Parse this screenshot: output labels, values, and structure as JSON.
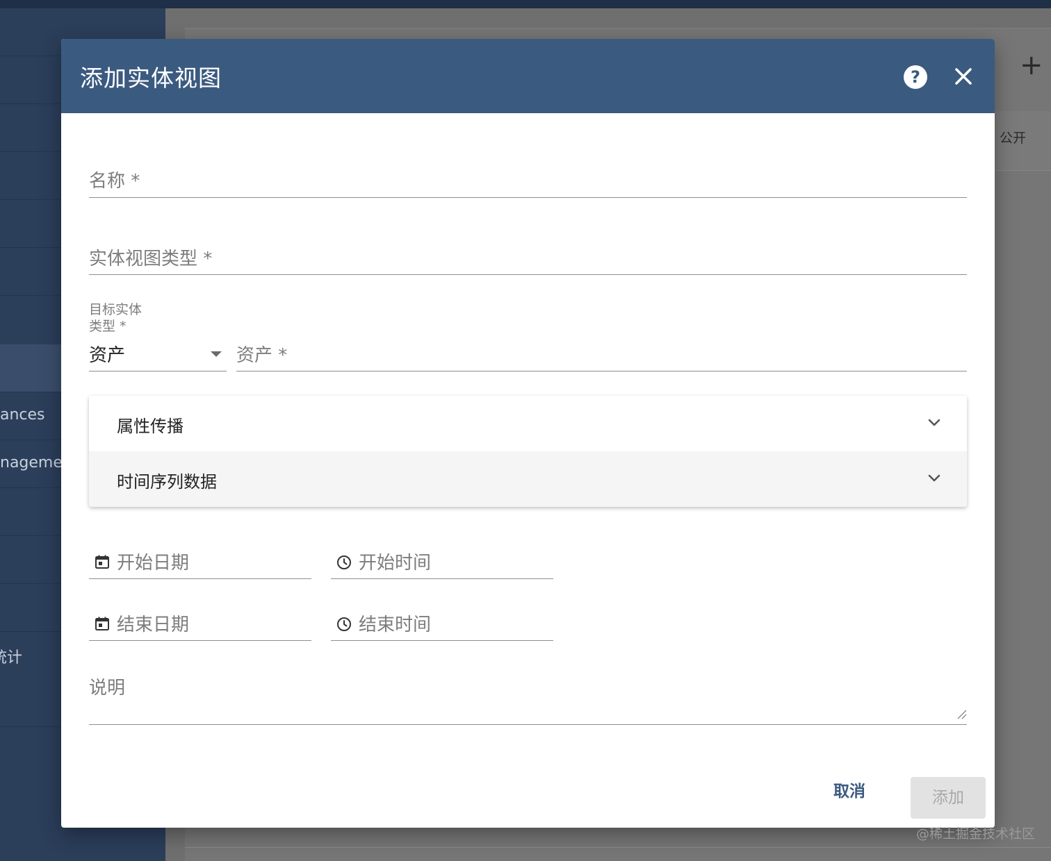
{
  "background": {
    "sidebar_items": [
      {
        "label": ""
      },
      {
        "label": ""
      },
      {
        "label": ""
      },
      {
        "label": ""
      },
      {
        "label": ""
      },
      {
        "label": ""
      },
      {
        "label": ""
      },
      {
        "label": "ances"
      },
      {
        "label": "nagemen"
      },
      {
        "label": ""
      },
      {
        "label": ""
      },
      {
        "label": ""
      },
      {
        "label": "统计"
      },
      {
        "label": ""
      },
      {
        "label": ""
      }
    ],
    "add_symbol": "+",
    "public_label": "公开"
  },
  "dialog": {
    "title": "添加实体视图",
    "help_symbol": "?",
    "fields": {
      "name_label": "名称 *",
      "type_label": "实体视图类型 *",
      "target_type_label_line1": "目标实体",
      "target_type_label_line2": "类型 *",
      "target_type_value": "资产",
      "target_entity_label": "资产 *",
      "start_date_label": "开始日期",
      "start_time_label": "开始时间",
      "end_date_label": "结束日期",
      "end_time_label": "结束时间",
      "description_label": "说明"
    },
    "panels": [
      {
        "title": "属性传播"
      },
      {
        "title": "时间序列数据"
      }
    ],
    "actions": {
      "cancel": "取消",
      "add": "添加"
    }
  },
  "watermark": "@稀土掘金技术社区",
  "colors": {
    "header": "#3b5a80",
    "sidebar": "#2b3e5a",
    "accent": "#3b5a80"
  }
}
